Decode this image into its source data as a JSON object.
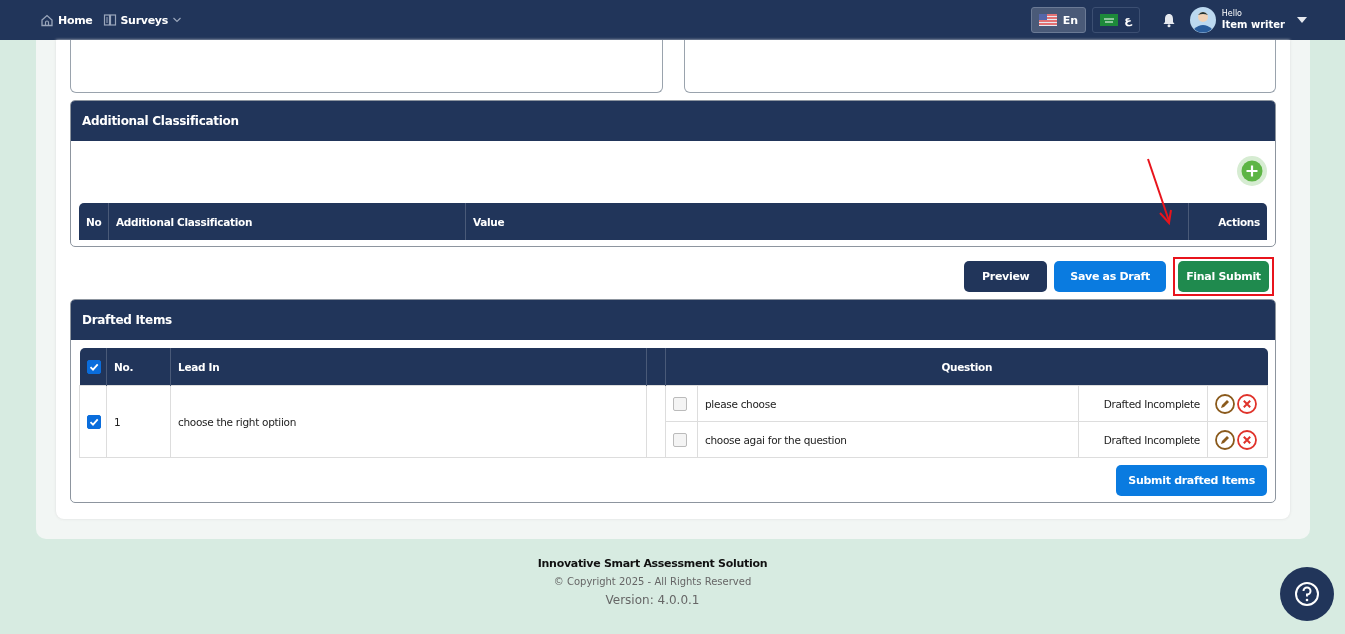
{
  "navbar": {
    "items": [
      {
        "label": "Home",
        "kind": "home"
      },
      {
        "label": "Surveys",
        "kind": "surveys"
      }
    ],
    "languages": [
      {
        "label": "En",
        "kind": "us",
        "selected": true
      },
      {
        "label": "ع",
        "kind": "sa",
        "selected": false
      }
    ],
    "user": {
      "greeting": "Hello",
      "name": "Item writer"
    }
  },
  "classification": {
    "title": "Additional Classification",
    "columns": [
      "No",
      "Additional Classification",
      "Value",
      "Actions"
    ]
  },
  "actions": [
    {
      "label": "Preview",
      "kind": "dark",
      "highlighted": false
    },
    {
      "label": "Save as Draft",
      "kind": "primary",
      "highlighted": false
    },
    {
      "label": "Final Submit",
      "kind": "success",
      "highlighted": true
    }
  ],
  "drafted": {
    "title": "Drafted Items",
    "select_all": true,
    "columns": [
      "No.",
      "Lead In",
      "Question"
    ],
    "rows": [
      {
        "checked": true,
        "no": "1",
        "lead_in": "choose the right optiion",
        "questions": [
          {
            "checked": false,
            "text": "please choose",
            "status": "Drafted Incomplete"
          },
          {
            "checked": false,
            "text": "choose agai  for the question",
            "status": "Drafted Incomplete"
          }
        ]
      }
    ],
    "submit": "Submit drafted Items"
  },
  "footer": {
    "title": "Innovative Smart Assessment Solution",
    "copyright": "© Copyright 2025 - All Rights Reserved",
    "version": "Version: 4.0.0.1"
  }
}
